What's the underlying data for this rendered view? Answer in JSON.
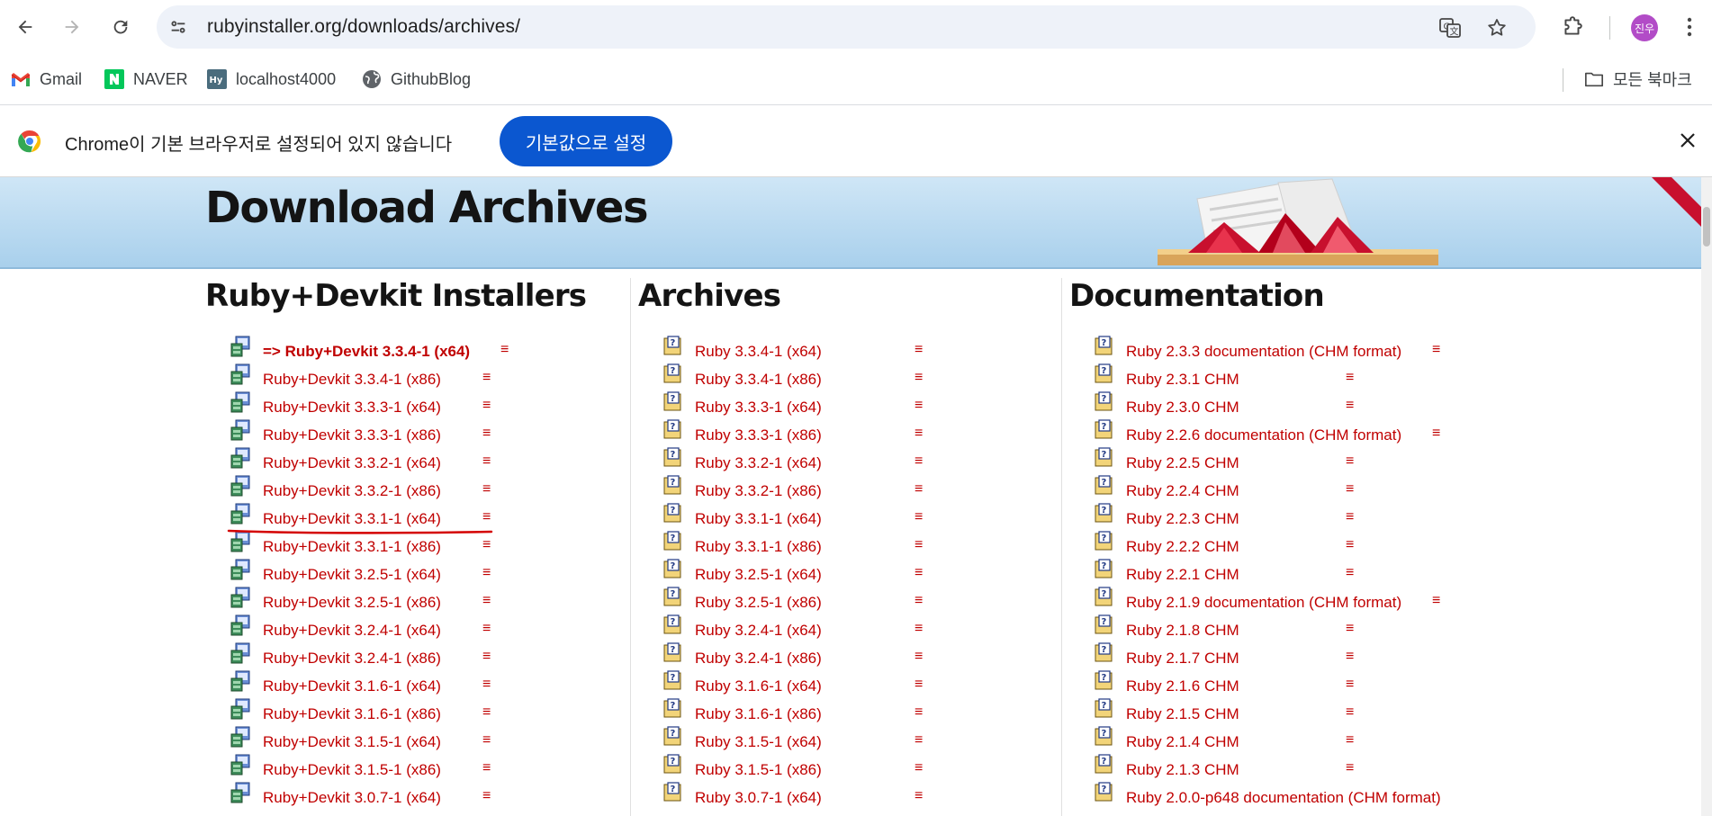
{
  "browser": {
    "url": "rubyinstaller.org/downloads/archives/",
    "avatar_text": "진우"
  },
  "bookmarks": {
    "items": [
      {
        "label": "Gmail",
        "icon": "gmail-icon"
      },
      {
        "label": "NAVER",
        "icon": "naver-icon"
      },
      {
        "label": "localhost4000",
        "icon": "hy-icon"
      },
      {
        "label": "GithubBlog",
        "icon": "globe-icon"
      }
    ],
    "all_bookmarks": "모든 북마크"
  },
  "infobar": {
    "message": "Chrome이 기본 브라우저로 설정되어 있지 않습니다",
    "button": "기본값으로 설정"
  },
  "page": {
    "title": "Download Archives",
    "menu_glyph": "≡",
    "installers": {
      "heading": "Ruby+Devkit Installers",
      "items": [
        "=> Ruby+Devkit 3.3.4-1 (x64)",
        "Ruby+Devkit 3.3.4-1 (x86)",
        "Ruby+Devkit 3.3.3-1 (x64)",
        "Ruby+Devkit 3.3.3-1 (x86)",
        "Ruby+Devkit 3.3.2-1 (x64)",
        "Ruby+Devkit 3.3.2-1 (x86)",
        "Ruby+Devkit 3.3.1-1 (x64)",
        "Ruby+Devkit 3.3.1-1 (x86)",
        "Ruby+Devkit 3.2.5-1 (x64)",
        "Ruby+Devkit 3.2.5-1 (x86)",
        "Ruby+Devkit 3.2.4-1 (x64)",
        "Ruby+Devkit 3.2.4-1 (x86)",
        "Ruby+Devkit 3.1.6-1 (x64)",
        "Ruby+Devkit 3.1.6-1 (x86)",
        "Ruby+Devkit 3.1.5-1 (x64)",
        "Ruby+Devkit 3.1.5-1 (x86)",
        "Ruby+Devkit 3.0.7-1 (x64)"
      ]
    },
    "archives": {
      "heading": "Archives",
      "items": [
        "Ruby 3.3.4-1 (x64)",
        "Ruby 3.3.4-1 (x86)",
        "Ruby 3.3.3-1 (x64)",
        "Ruby 3.3.3-1 (x86)",
        "Ruby 3.3.2-1 (x64)",
        "Ruby 3.3.2-1 (x86)",
        "Ruby 3.3.1-1 (x64)",
        "Ruby 3.3.1-1 (x86)",
        "Ruby 3.2.5-1 (x64)",
        "Ruby 3.2.5-1 (x86)",
        "Ruby 3.2.4-1 (x64)",
        "Ruby 3.2.4-1 (x86)",
        "Ruby 3.1.6-1 (x64)",
        "Ruby 3.1.6-1 (x86)",
        "Ruby 3.1.5-1 (x64)",
        "Ruby 3.1.5-1 (x86)",
        "Ruby 3.0.7-1 (x64)"
      ]
    },
    "documentation": {
      "heading": "Documentation",
      "items": [
        {
          "label": "Ruby 2.3.3 documentation (CHM format)",
          "menu": true
        },
        {
          "label": "Ruby 2.3.1 CHM",
          "menu": true
        },
        {
          "label": "Ruby 2.3.0 CHM",
          "menu": true
        },
        {
          "label": "Ruby 2.2.6 documentation (CHM format)",
          "menu": true
        },
        {
          "label": "Ruby 2.2.5 CHM",
          "menu": true
        },
        {
          "label": "Ruby 2.2.4 CHM",
          "menu": true
        },
        {
          "label": "Ruby 2.2.3 CHM",
          "menu": true
        },
        {
          "label": "Ruby 2.2.2 CHM",
          "menu": true
        },
        {
          "label": "Ruby 2.2.1 CHM",
          "menu": true
        },
        {
          "label": "Ruby 2.1.9 documentation (CHM format)",
          "menu": true
        },
        {
          "label": "Ruby 2.1.8 CHM",
          "menu": true
        },
        {
          "label": "Ruby 2.1.7 CHM",
          "menu": true
        },
        {
          "label": "Ruby 2.1.6 CHM",
          "menu": true
        },
        {
          "label": "Ruby 2.1.5 CHM",
          "menu": true
        },
        {
          "label": "Ruby 2.1.4 CHM",
          "menu": true
        },
        {
          "label": "Ruby 2.1.3 CHM",
          "menu": true
        },
        {
          "label": "Ruby 2.0.0-p648 documentation (CHM format)",
          "menu": false
        }
      ]
    }
  },
  "colors": {
    "link": "#c00000",
    "accent": "#0b57d0",
    "banner": "#b9dcf2",
    "annotation": "#d40000"
  }
}
